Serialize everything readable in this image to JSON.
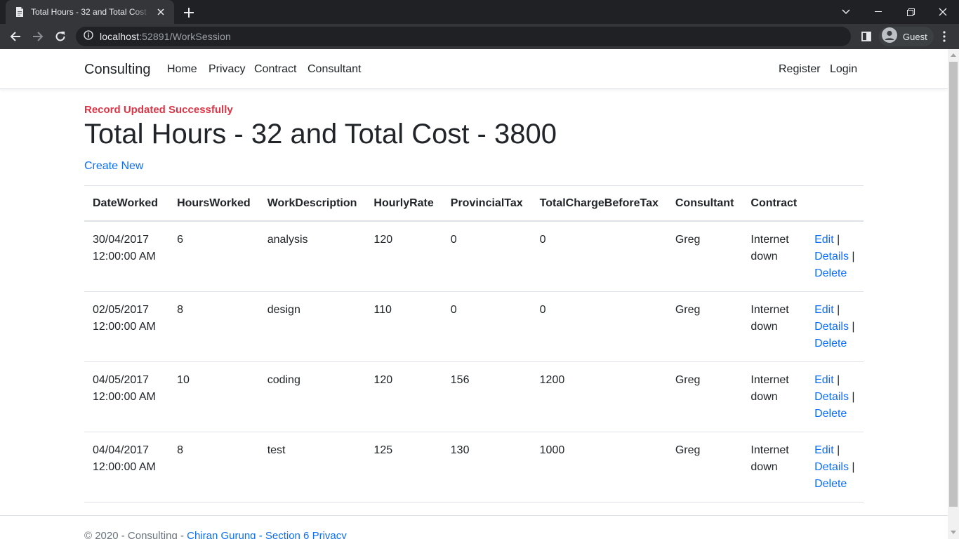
{
  "browser": {
    "tab_title": "Total Hours - 32 and Total Cost - 3800",
    "url_host": "localhost",
    "url_rest": ":52891/WorkSession",
    "profile_label": "Guest"
  },
  "nav": {
    "brand": "Consulting",
    "links": [
      "Home",
      "Privacy",
      "Contract",
      "Consultant"
    ],
    "register": "Register",
    "login": "Login"
  },
  "main": {
    "flash_message": "Record Updated Successfully",
    "title": "Total Hours - 32 and Total Cost - 3800",
    "create_new": "Create New"
  },
  "table": {
    "headers": [
      "DateWorked",
      "HoursWorked",
      "WorkDescription",
      "HourlyRate",
      "ProvincialTax",
      "TotalChargeBeforeTax",
      "Consultant",
      "Contract"
    ],
    "rows": [
      {
        "date": "30/04/2017",
        "time": "12:00:00 AM",
        "hours": "6",
        "description": "analysis",
        "rate": "120",
        "tax": "0",
        "charge": "0",
        "consultant": "Greg",
        "contract_1": "Internet",
        "contract_2": "down"
      },
      {
        "date": "02/05/2017",
        "time": "12:00:00 AM",
        "hours": "8",
        "description": "design",
        "rate": "110",
        "tax": "0",
        "charge": "0",
        "consultant": "Greg",
        "contract_1": "Internet",
        "contract_2": "down"
      },
      {
        "date": "04/05/2017",
        "time": "12:00:00 AM",
        "hours": "10",
        "description": "coding",
        "rate": "120",
        "tax": "156",
        "charge": "1200",
        "consultant": "Greg",
        "contract_1": "Internet",
        "contract_2": "down"
      },
      {
        "date": "04/04/2017",
        "time": "12:00:00 AM",
        "hours": "8",
        "description": "test",
        "rate": "125",
        "tax": "130",
        "charge": "1000",
        "consultant": "Greg",
        "contract_1": "Internet",
        "contract_2": "down"
      }
    ],
    "actions": {
      "edit": "Edit",
      "details": "Details",
      "delete": "Delete",
      "separator": "|"
    }
  },
  "footer": {
    "text": "© 2020 - Consulting - ",
    "author_link": "Chiran Gurung - Section 6",
    "privacy_link": "Privacy"
  }
}
